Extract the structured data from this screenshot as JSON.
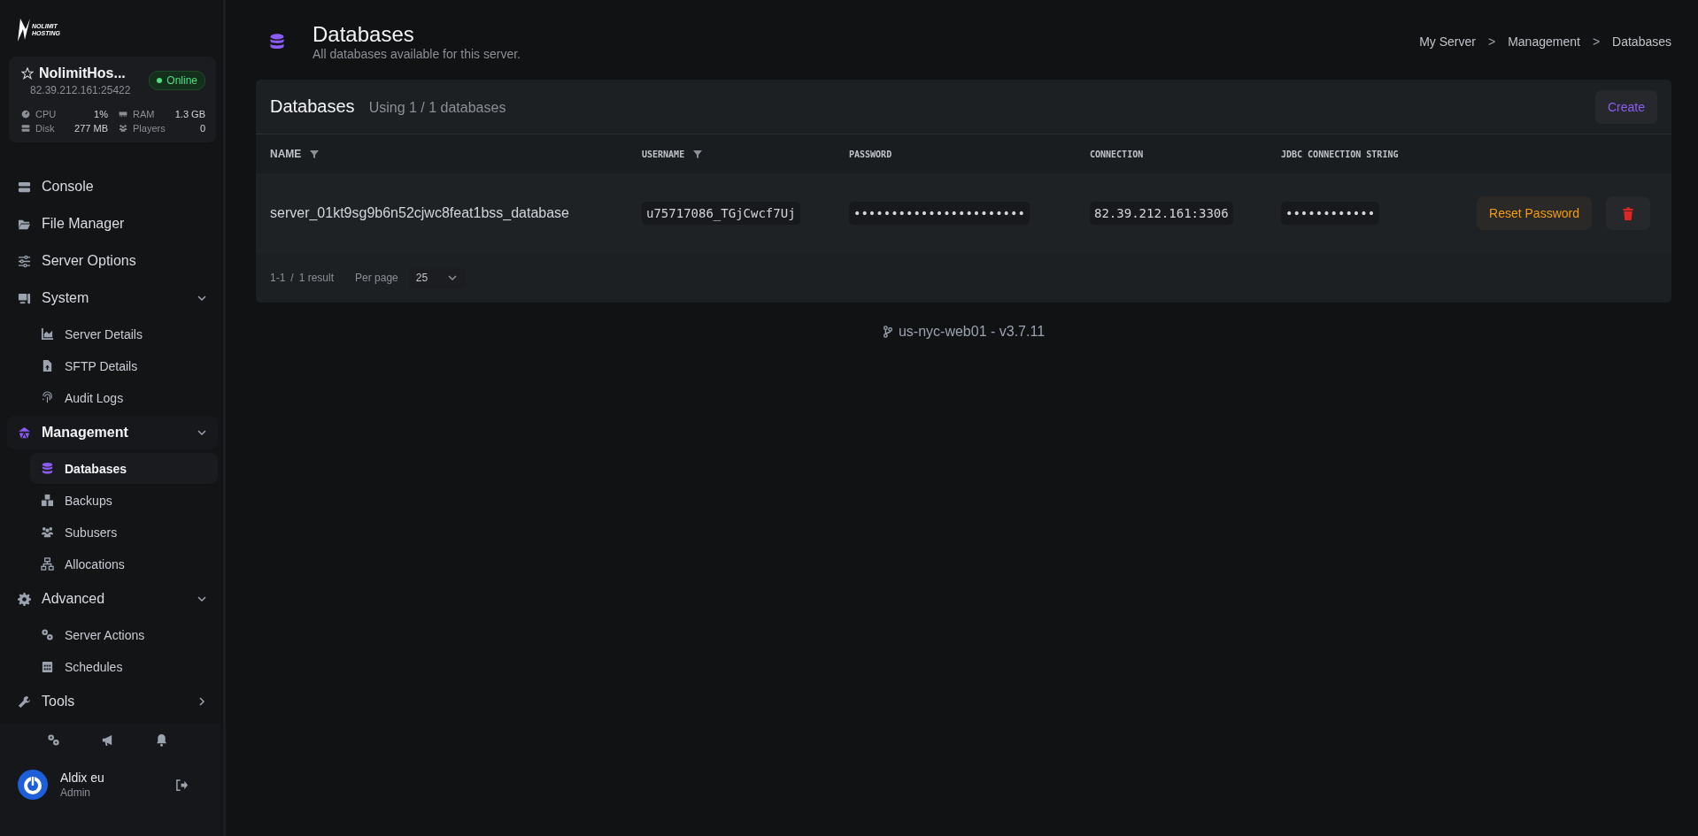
{
  "sidebar": {
    "logo": {
      "line_1": "NOLIMIT",
      "line_2": "HOSTING"
    },
    "server": {
      "name": "NolimitHos...",
      "address": "82.39.212.161:25422",
      "status": "Online",
      "online": true,
      "stats": [
        {
          "label": "CPU",
          "value": "1%"
        },
        {
          "label": "RAM",
          "value": "1.3 GB"
        },
        {
          "label": "Disk",
          "value": "277 MB"
        },
        {
          "label": "Players",
          "value": "0"
        }
      ]
    },
    "nav": [
      {
        "kind": "link",
        "label": "Console",
        "selected": false
      },
      {
        "kind": "link",
        "label": "File Manager",
        "selected": false
      },
      {
        "kind": "link",
        "label": "Server Options",
        "selected": false
      },
      {
        "kind": "group",
        "label": "System",
        "selected": false,
        "expanded": true,
        "children": [
          {
            "label": "Server Details",
            "selected": false
          },
          {
            "label": "SFTP Details",
            "selected": false
          },
          {
            "label": "Audit Logs",
            "selected": false
          }
        ]
      },
      {
        "kind": "group",
        "label": "Management",
        "selected": true,
        "expanded": true,
        "children": [
          {
            "label": "Databases",
            "selected": true
          },
          {
            "label": "Backups",
            "selected": false
          },
          {
            "label": "Subusers",
            "selected": false
          },
          {
            "label": "Allocations",
            "selected": false
          }
        ]
      },
      {
        "kind": "group",
        "label": "Advanced",
        "selected": false,
        "expanded": true,
        "children": [
          {
            "label": "Server Actions",
            "selected": false
          },
          {
            "label": "Schedules",
            "selected": false
          }
        ]
      },
      {
        "kind": "group",
        "label": "Tools",
        "selected": false,
        "expanded": false
      }
    ],
    "user": {
      "name": "Aldix eu",
      "role": "Admin"
    }
  },
  "header": {
    "title": "Databases",
    "subtitle": "All databases available for this server.",
    "breadcrumbs": [
      "My Server",
      "Management",
      "Databases"
    ],
    "separator": ">"
  },
  "panel": {
    "title": "Databases",
    "usage": "Using 1 / 1 databases",
    "create_button": "Create",
    "columns": [
      {
        "label": "NAME",
        "filter": true
      },
      {
        "label": "USERNAME",
        "filter": true
      },
      {
        "label": "PASSWORD",
        "filter": false
      },
      {
        "label": "CONNECTION",
        "filter": false
      },
      {
        "label": "JDBC CONNECTION STRING",
        "filter": false
      }
    ],
    "rows": [
      {
        "name": "server_01kt9sg9b6n52cjwc8feat1bss_database",
        "username": "u75717086_TGjCwcf7Uj",
        "password": "•••••••••••••••••••••••",
        "connection": "82.39.212.161:3306",
        "jdbc": "••••••••••••",
        "reset_button": "Reset Password"
      }
    ],
    "footer": {
      "range": "1-1",
      "separator": "/",
      "result": "1 result",
      "per_page_label": "Per page",
      "per_page": "25"
    }
  },
  "version": "us-nyc-web01 - v3.7.11"
}
